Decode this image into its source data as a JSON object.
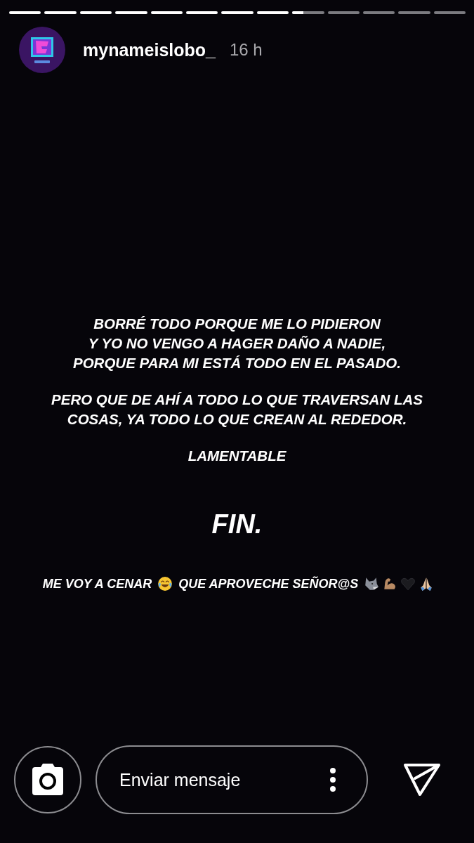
{
  "progress": [
    {
      "level": 1
    },
    {
      "level": 1
    },
    {
      "level": 1
    },
    {
      "level": 1
    },
    {
      "level": 1
    },
    {
      "level": 1
    },
    {
      "level": 1
    },
    {
      "level": 1
    },
    {
      "level": 0.35
    },
    {
      "level": 0
    },
    {
      "level": 0
    },
    {
      "level": 0
    },
    {
      "level": 0
    }
  ],
  "header": {
    "username": "mynameislobo_",
    "time": "16 h"
  },
  "story": [
    {
      "kind": "body",
      "text": "BORRÉ TODO PORQUE ME LO PIDIERON\nY YO NO VENGO A HAGER DAÑO A NADIE,\nPORQUE PARA MI ESTÁ TODO EN EL PASADO."
    },
    {
      "kind": "body",
      "text": "PERO QUE DE AHÍ A TODO LO QUE TRAVERSAN LAS\nCOSAS, YA TODO LO QUE CREAN AL REDEDOR."
    },
    {
      "kind": "body",
      "text": "LAMENTABLE"
    },
    {
      "kind": "title",
      "text": "FIN."
    }
  ],
  "closing_line": [
    {
      "kind": "text",
      "text": "ME VOY A CENAR"
    },
    {
      "kind": "laughing"
    },
    {
      "kind": "text",
      "text": "QUE APROVECHE SEÑOR@S"
    },
    {
      "kind": "wolf"
    },
    {
      "kind": "muscle"
    },
    {
      "kind": "heart"
    },
    {
      "kind": "pray"
    }
  ],
  "reply_bar": {
    "placeholder": "Enviar mensaje"
  }
}
